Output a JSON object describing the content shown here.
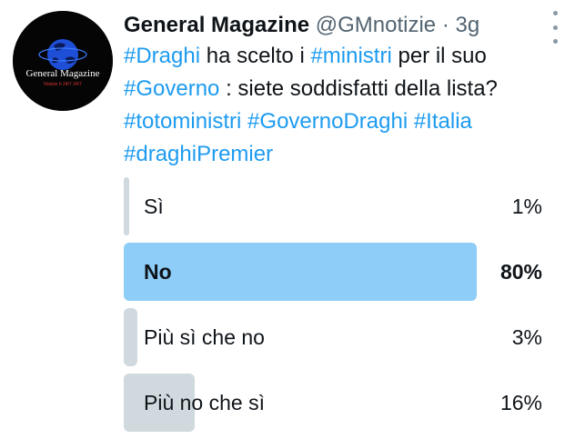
{
  "tweet": {
    "author_name": "General Magazine",
    "handle": "@GMnotizie",
    "separator": "·",
    "time": "3g",
    "avatar_text": "General Magazine",
    "avatar_subtext": "Notizie h 24/7 24/7",
    "text_parts": [
      {
        "t": "#Draghi",
        "tag": true
      },
      {
        "t": " ha scelto i ",
        "tag": false
      },
      {
        "t": "#ministri",
        "tag": true
      },
      {
        "t": " per il suo ",
        "tag": false
      },
      {
        "t": "#Governo",
        "tag": true
      },
      {
        "t": " : siete soddisfatti della lista? ",
        "tag": false
      },
      {
        "t": "#totoministri",
        "tag": true
      },
      {
        "t": " ",
        "tag": false
      },
      {
        "t": "#GovernoDraghi",
        "tag": true
      },
      {
        "t": " ",
        "tag": false
      },
      {
        "t": "#Italia",
        "tag": true
      },
      {
        "t": " ",
        "tag": false
      },
      {
        "t": "#draghiPremier",
        "tag": true
      }
    ]
  },
  "poll": {
    "options": [
      {
        "label": "Sì",
        "percent_text": "1%",
        "percent": 1,
        "winner": false
      },
      {
        "label": "No",
        "percent_text": "80%",
        "percent": 80,
        "winner": true
      },
      {
        "label": "Più sì che no",
        "percent_text": "3%",
        "percent": 3,
        "winner": false
      },
      {
        "label": "Più no che sì",
        "percent_text": "16%",
        "percent": 16,
        "winner": false
      }
    ]
  },
  "colors": {
    "link": "#1d9bf0",
    "winner_bar": "#8ecdf8",
    "bar": "#cfd9de",
    "muted": "#536471"
  },
  "icons": [
    "more-options-icon",
    "globe-icon"
  ]
}
